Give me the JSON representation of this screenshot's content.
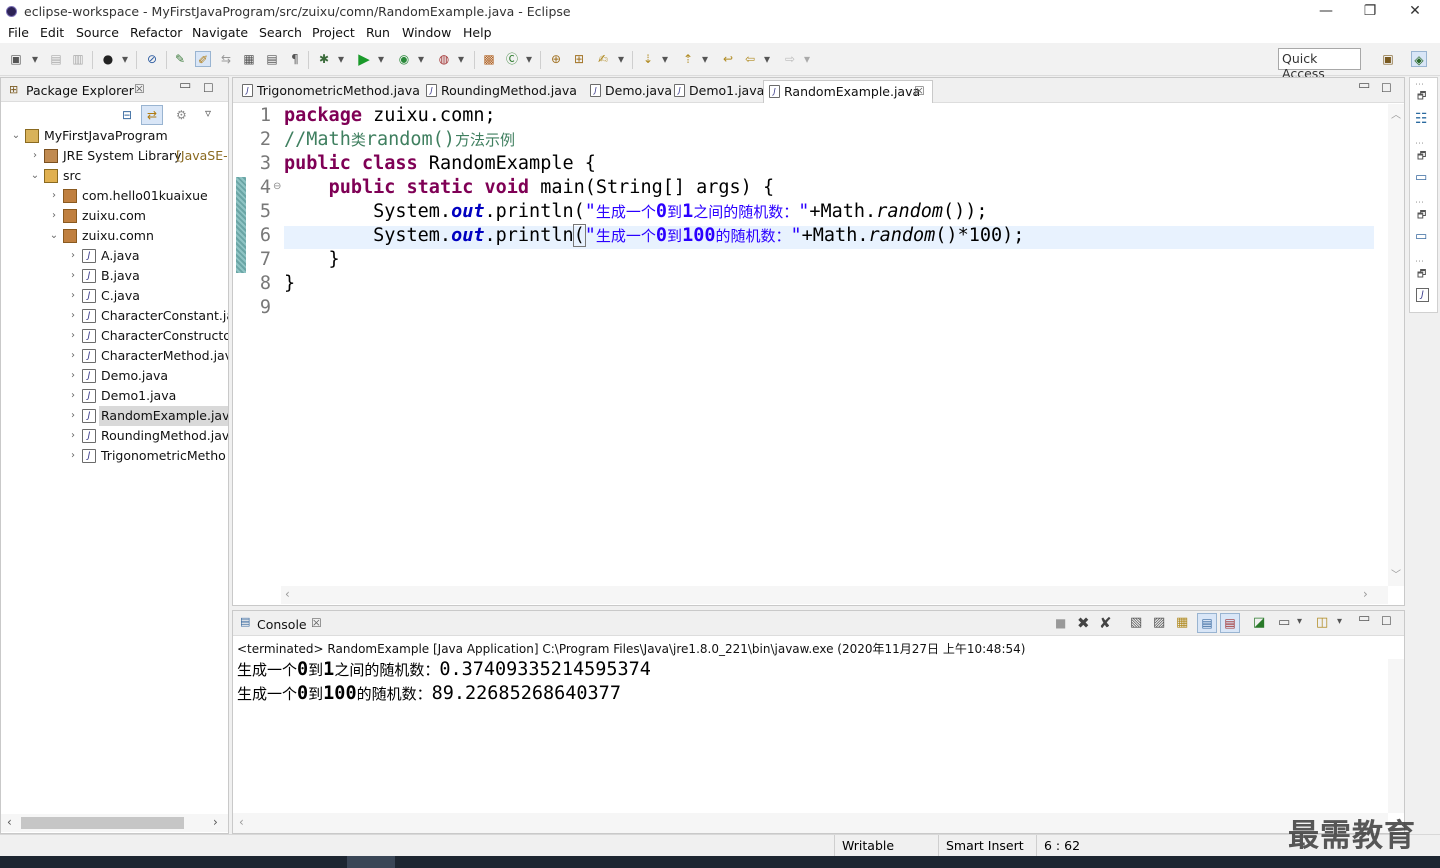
{
  "window": {
    "title": "eclipse-workspace - MyFirstJavaProgram/src/zuixu/comn/RandomExample.java - Eclipse",
    "minimize": "—",
    "restore": "❐",
    "close": "✕"
  },
  "menu": [
    "File",
    "Edit",
    "Source",
    "Refactor",
    "Navigate",
    "Search",
    "Project",
    "Run",
    "Window",
    "Help"
  ],
  "toolbar": {
    "quick_access": "Quick Access"
  },
  "package_explorer": {
    "title": "Package Explorer",
    "close": "☒",
    "tree": [
      {
        "label": "MyFirstJavaProgram",
        "level": 0,
        "twisty": "⌄",
        "icon": "project-icon"
      },
      {
        "label": "JRE System Library",
        "extra": "[JavaSE-",
        "level": 1,
        "twisty": "›",
        "icon": "library-icon"
      },
      {
        "label": "src",
        "level": 1,
        "twisty": "⌄",
        "icon": "source-folder-icon"
      },
      {
        "label": "com.hello01kuaixue",
        "level": 2,
        "twisty": "›",
        "icon": "package-icon"
      },
      {
        "label": "zuixu.com",
        "level": 2,
        "twisty": "›",
        "icon": "package-icon"
      },
      {
        "label": "zuixu.comn",
        "level": 2,
        "twisty": "⌄",
        "icon": "package-icon"
      },
      {
        "label": "A.java",
        "level": 3,
        "twisty": "›",
        "icon": "java-file-icon"
      },
      {
        "label": "B.java",
        "level": 3,
        "twisty": "›",
        "icon": "java-file-icon"
      },
      {
        "label": "C.java",
        "level": 3,
        "twisty": "›",
        "icon": "java-file-icon"
      },
      {
        "label": "CharacterConstant.ja",
        "level": 3,
        "twisty": "›",
        "icon": "java-file-icon"
      },
      {
        "label": "CharacterConstructor",
        "level": 3,
        "twisty": "›",
        "icon": "java-file-icon"
      },
      {
        "label": "CharacterMethod.jav",
        "level": 3,
        "twisty": "›",
        "icon": "java-file-icon"
      },
      {
        "label": "Demo.java",
        "level": 3,
        "twisty": "›",
        "icon": "java-file-icon"
      },
      {
        "label": "Demo1.java",
        "level": 3,
        "twisty": "›",
        "icon": "java-file-icon"
      },
      {
        "label": "RandomExample.java",
        "level": 3,
        "twisty": "›",
        "icon": "java-file-icon",
        "selected": true
      },
      {
        "label": "RoundingMethod.jav",
        "level": 3,
        "twisty": "›",
        "icon": "java-file-icon"
      },
      {
        "label": "TrigonometricMetho",
        "level": 3,
        "twisty": "›",
        "icon": "java-file-icon"
      }
    ]
  },
  "editor": {
    "tabs": [
      {
        "label": "TrigonometricMethod.java",
        "active": false
      },
      {
        "label": "RoundingMethod.java",
        "active": false
      },
      {
        "label": "Demo.java",
        "active": false
      },
      {
        "label": "Demo1.java",
        "active": false
      },
      {
        "label": "RandomExample.java",
        "active": true
      }
    ],
    "tab_close": "☒",
    "line_numbers": [
      "1",
      "2",
      "3",
      "4",
      "5",
      "6",
      "7",
      "8",
      "9"
    ],
    "fold_marker": "⊖",
    "code": {
      "l1_kw": "package",
      "l1_rest": " zuixu.comn;",
      "l2_comment_a": "//Math",
      "l2_comment_b": "类",
      "l2_comment_c": "random()",
      "l2_comment_d": "方法示例",
      "l3_kw1": "public",
      "l3_kw2": "class",
      "l3_rest": " RandomExample {",
      "l4_indent": "    ",
      "l4_kw1": "public",
      "l4_kw2": "static",
      "l4_kw3": "void",
      "l4_rest": " main(String[] args) {",
      "l5_a": "        System.",
      "l5_out": "out",
      "l5_b": ".println(",
      "l5_s1": "\"",
      "l5_s2": "生成一个",
      "l5_s3": "0",
      "l5_s4": "到",
      "l5_s5": "1",
      "l5_s6": "之间的随机数：",
      "l5_s7": "\"",
      "l5_c": "+Math.",
      "l5_rand": "random",
      "l5_d": "());",
      "l6_a": "        System.",
      "l6_out": "out",
      "l6_b": ".println",
      "l6_paren": "(",
      "l6_s1": "\"",
      "l6_s2": "生成一个",
      "l6_s3": "0",
      "l6_s4": "到",
      "l6_s5": "100",
      "l6_s6": "的随机数：",
      "l6_s7": "\"",
      "l6_c": "+Math.",
      "l6_rand": "random",
      "l6_d": "()*100);",
      "l7": "    }",
      "l8": "}"
    }
  },
  "console": {
    "title": "Console",
    "close": "☒",
    "terminated_line": "<terminated> RandomExample [Java Application] C:\\Program Files\\Java\\jre1.8.0_221\\bin\\javaw.exe (2020年11月27日 上午10:48:54)",
    "out1_a": "生成一个",
    "out1_b": "0",
    "out1_c": "到",
    "out1_d": "1",
    "out1_e": "之间的随机数：",
    "out1_f": "0.37409335214595374",
    "out2_a": "生成一个",
    "out2_b": "0",
    "out2_c": "到",
    "out2_d": "100",
    "out2_e": "的随机数：",
    "out2_f": "89.22685268640377"
  },
  "status": {
    "writable": "Writable",
    "insert_mode": "Smart Insert",
    "position": "6 : 62"
  },
  "watermark": "最需教育",
  "colors": {
    "keyword": "#7f0055",
    "comment": "#3f7f5f",
    "string": "#2a00ff",
    "field": "#0000c0",
    "current_line": "#e8f2fe",
    "selection": "#d9d9d9"
  }
}
